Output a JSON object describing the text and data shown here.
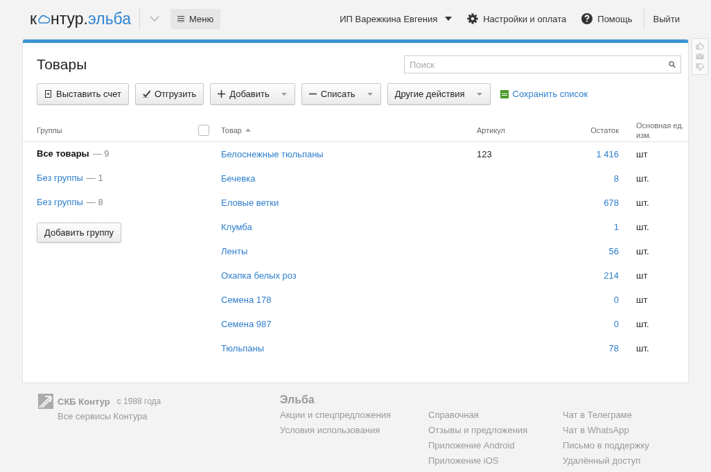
{
  "header": {
    "logo": {
      "left": "к",
      "right": "нтур.",
      "accent": "эльба"
    },
    "menu_button": "Меню",
    "user": "ИП Варежкина Евгения",
    "settings": "Настройки и оплата",
    "help": "Помощь",
    "logout": "Выйти"
  },
  "page": {
    "title": "Товары",
    "search": {
      "placeholder": "Поиск"
    },
    "toolbar": [
      {
        "label": "Выставить счет",
        "kind": "invoice",
        "dropdown": false
      },
      {
        "label": "Отгрузить",
        "kind": "ship",
        "dropdown": false
      },
      {
        "label": "Добавить",
        "kind": "plus",
        "dropdown": true
      },
      {
        "label": "Списать",
        "kind": "minus",
        "dropdown": true
      },
      {
        "label": "Другие действия",
        "kind": "plain",
        "dropdown": true
      }
    ],
    "save_link": "Сохранить список",
    "groups": {
      "heading": "Группы",
      "items": [
        {
          "name": "Все товары",
          "count": "— 9",
          "selected": true
        },
        {
          "name": "Без группы",
          "count": "— 1",
          "selected": false
        },
        {
          "name": "Без группы",
          "count": "— 8",
          "selected": false
        }
      ],
      "add_button": "Добавить группу"
    },
    "table": {
      "select_all": {
        "checked": false
      },
      "columns": [
        "Товар",
        "Артикул",
        "Остаток",
        "Основная ед. изм."
      ],
      "rows": [
        {
          "name": "Белоснежные тюльпаны",
          "article": "123",
          "stock": "1 416",
          "unit": "шт"
        },
        {
          "name": "Бечевка",
          "article": "",
          "stock": "8",
          "unit": "шт."
        },
        {
          "name": "Еловые ветки",
          "article": "",
          "stock": "678",
          "unit": "шт."
        },
        {
          "name": "Клумба",
          "article": "",
          "stock": "1",
          "unit": "шт."
        },
        {
          "name": "Ленты",
          "article": "",
          "stock": "56",
          "unit": "шт."
        },
        {
          "name": "Охапка белых роз",
          "article": "",
          "stock": "214",
          "unit": "шт"
        },
        {
          "name": "Семена 178",
          "article": "",
          "stock": "0",
          "unit": "шт"
        },
        {
          "name": "Семена 987",
          "article": "",
          "stock": "0",
          "unit": "шт."
        },
        {
          "name": "Тюльпаны",
          "article": "",
          "stock": "78",
          "unit": "шт."
        }
      ]
    }
  },
  "footer": {
    "brand": "СКБ Контур",
    "since": "с 1988 года",
    "all_services": "Все сервисы Контура",
    "product": "Эльба",
    "columns": [
      [
        "Акции и спецпредложения",
        "Условия использования"
      ],
      [
        "Справочная",
        "Отзывы и предложения",
        "Приложение Android",
        "Приложение iOS"
      ],
      [
        "Чат в Телеграме",
        "Чат в WhatsApp",
        "Письмо в поддержку",
        "Удалённый доступ"
      ]
    ]
  }
}
